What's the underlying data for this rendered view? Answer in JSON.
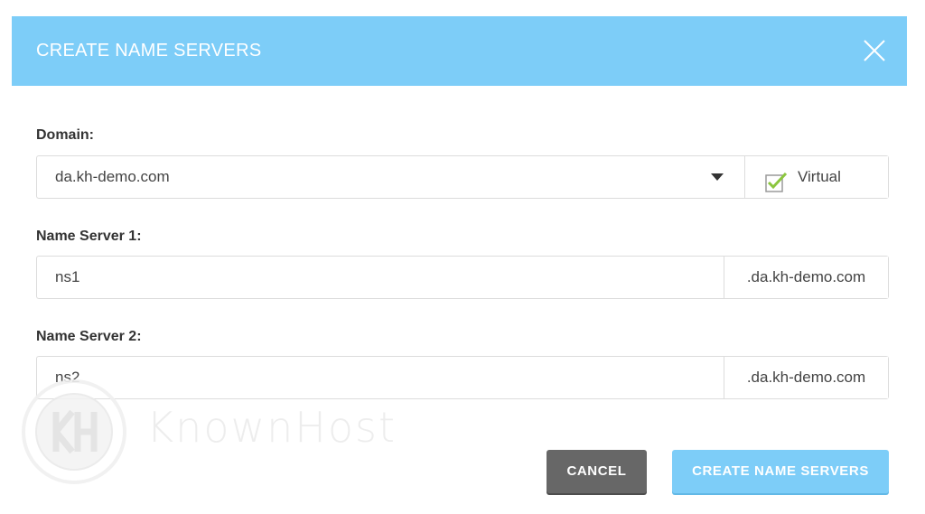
{
  "dialog": {
    "title": "CREATE NAME SERVERS"
  },
  "domain": {
    "label": "Domain:",
    "selected": "da.kh-demo.com",
    "virtual_checked": true,
    "virtual_label": "Virtual"
  },
  "ns1": {
    "label": "Name Server 1:",
    "value": "ns1",
    "suffix": ".da.kh-demo.com"
  },
  "ns2": {
    "label": "Name Server 2:",
    "value": "ns2",
    "suffix": ".da.kh-demo.com"
  },
  "watermark": {
    "text": "KnownHost",
    "logo_letters": "KH"
  },
  "buttons": {
    "cancel": "CANCEL",
    "create": "CREATE NAME SERVERS"
  },
  "colors": {
    "header": "#7dcdf8",
    "primary_button": "#7dcdf8",
    "cancel_button": "#676767",
    "checkmark": "#8cc63f"
  },
  "icons": {
    "close": "close-icon",
    "caret": "caret-down-icon",
    "checkbox": "checkbox-checked-icon"
  }
}
